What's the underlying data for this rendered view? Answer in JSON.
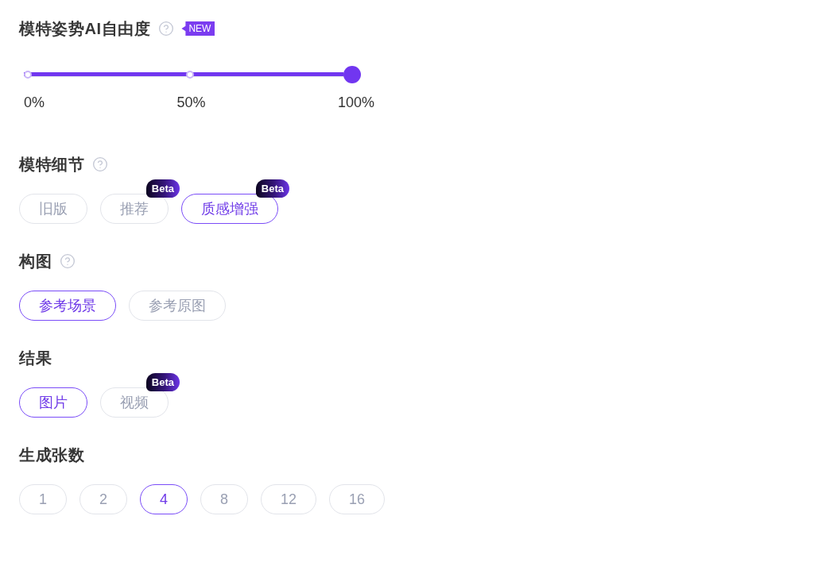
{
  "sections": [
    {
      "kind": "slider",
      "title": "模特姿势AI自由度",
      "help": true,
      "badge": "NEW",
      "slider": {
        "level": 1,
        "marks": [
          "0%",
          "50%",
          "100%"
        ]
      }
    },
    {
      "kind": "options",
      "title": "模特细节",
      "help": true,
      "options": [
        {
          "label": "旧版",
          "selected": false
        },
        {
          "label": "推荐",
          "selected": false,
          "badge": "Beta"
        },
        {
          "label": "质感增强",
          "selected": true,
          "badge": "Beta"
        }
      ]
    },
    {
      "kind": "options",
      "title": "构图",
      "help": true,
      "options": [
        {
          "label": "参考场景",
          "selected": true
        },
        {
          "label": "参考原图",
          "selected": false
        }
      ]
    },
    {
      "kind": "options",
      "title": "结果",
      "help": false,
      "options": [
        {
          "label": "图片",
          "selected": true
        },
        {
          "label": "视频",
          "selected": false,
          "badge": "Beta"
        }
      ]
    },
    {
      "kind": "options",
      "title": "生成张数",
      "help": false,
      "options": [
        {
          "label": "1",
          "selected": false
        },
        {
          "label": "2",
          "selected": false
        },
        {
          "label": "4",
          "selected": true
        },
        {
          "label": "8",
          "selected": false
        },
        {
          "label": "12",
          "selected": false
        },
        {
          "label": "16",
          "selected": false
        }
      ]
    }
  ]
}
